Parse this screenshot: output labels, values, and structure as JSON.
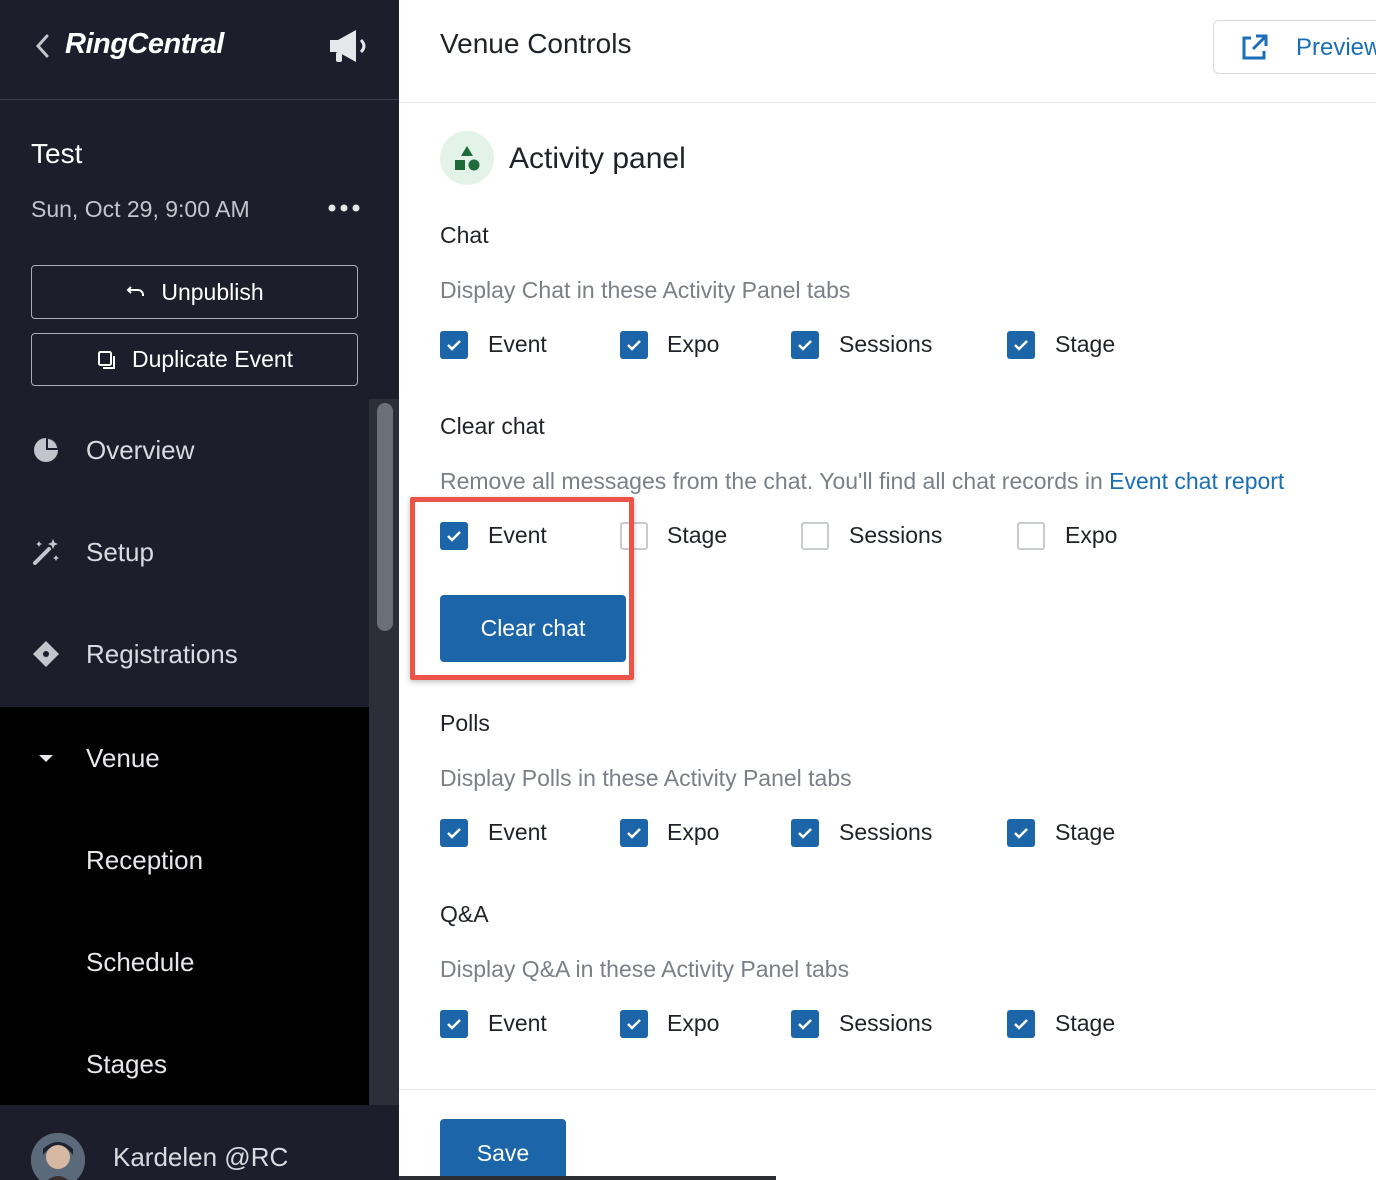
{
  "sidebar": {
    "logo": "RingCentral",
    "event_title": "Test",
    "event_date": "Sun, Oct 29, 9:00 AM",
    "unpublish_label": "Unpublish",
    "duplicate_label": "Duplicate Event",
    "nav": [
      {
        "label": "Overview",
        "icon": "pie-chart-icon"
      },
      {
        "label": "Setup",
        "icon": "magic-wand-icon"
      },
      {
        "label": "Registrations",
        "icon": "ticket-icon"
      },
      {
        "label": "Venue",
        "icon": "caret-down-icon"
      },
      {
        "label": "Reception"
      },
      {
        "label": "Schedule"
      },
      {
        "label": "Stages"
      }
    ],
    "user_name": "Kardelen @RC"
  },
  "header": {
    "title": "Venue Controls",
    "preview_label": "Preview"
  },
  "panel": {
    "title": "Activity panel",
    "sections": {
      "chat": {
        "title": "Chat",
        "description": "Display Chat in these Activity Panel tabs",
        "options": [
          {
            "label": "Event",
            "checked": true
          },
          {
            "label": "Expo",
            "checked": true
          },
          {
            "label": "Sessions",
            "checked": true
          },
          {
            "label": "Stage",
            "checked": true
          }
        ]
      },
      "clear_chat": {
        "title": "Clear chat",
        "description": "Remove all messages from the chat. You'll find all chat records in ",
        "link": "Event chat report",
        "options": [
          {
            "label": "Event",
            "checked": true
          },
          {
            "label": "Stage",
            "checked": false
          },
          {
            "label": "Sessions",
            "checked": false
          },
          {
            "label": "Expo",
            "checked": false
          }
        ],
        "button_label": "Clear chat"
      },
      "polls": {
        "title": "Polls",
        "description": "Display Polls in these Activity Panel tabs",
        "options": [
          {
            "label": "Event",
            "checked": true
          },
          {
            "label": "Expo",
            "checked": true
          },
          {
            "label": "Sessions",
            "checked": true
          },
          {
            "label": "Stage",
            "checked": true
          }
        ]
      },
      "qa": {
        "title": "Q&A",
        "description": "Display Q&A in these Activity Panel tabs",
        "options": [
          {
            "label": "Event",
            "checked": true
          },
          {
            "label": "Expo",
            "checked": true
          },
          {
            "label": "Sessions",
            "checked": true
          },
          {
            "label": "Stage",
            "checked": true
          }
        ]
      }
    }
  },
  "footer": {
    "save_label": "Save"
  },
  "colors": {
    "sidebar_bg": "#1c1f2b",
    "accent": "#1b65a8",
    "highlight": "#ec5448"
  }
}
